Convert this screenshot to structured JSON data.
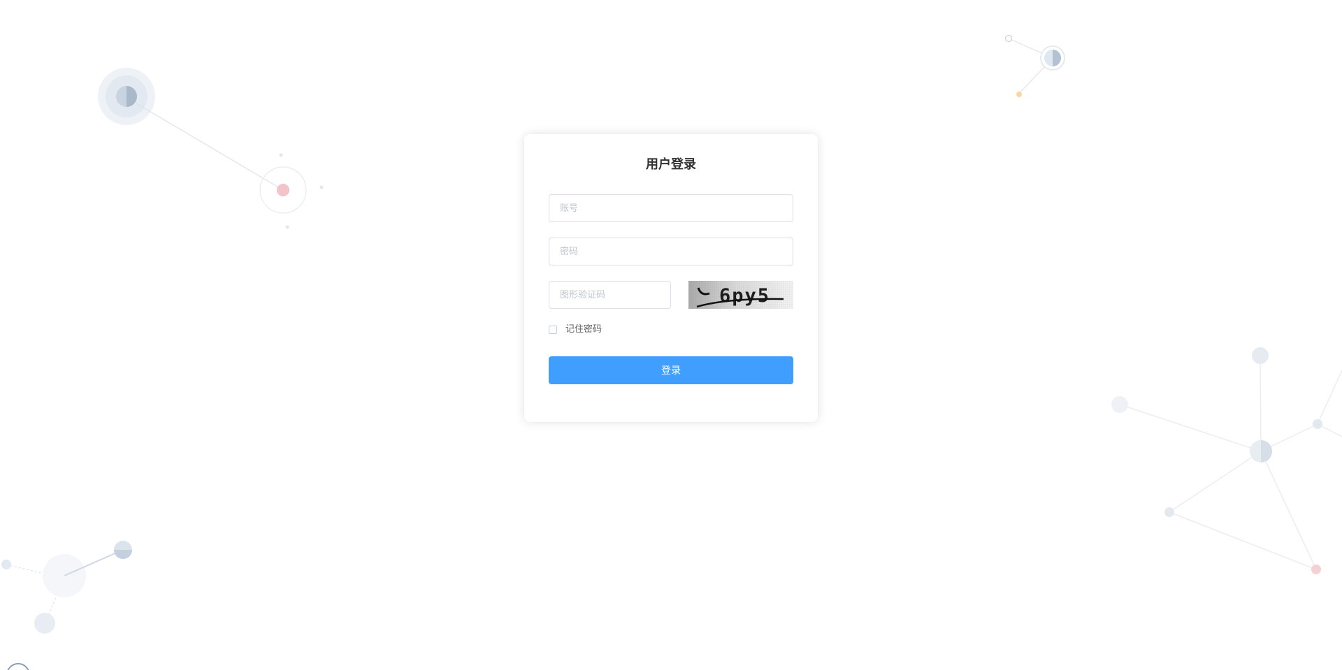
{
  "login": {
    "title": "用户登录",
    "account": {
      "value": "",
      "placeholder": "账号"
    },
    "password": {
      "value": "",
      "placeholder": "密码"
    },
    "captcha": {
      "value": "",
      "placeholder": "图形验证码",
      "image_text": "6py5"
    },
    "remember": {
      "label": "记住密码",
      "checked": false
    },
    "submit_label": "登录"
  },
  "colors": {
    "primary": "#409eff",
    "title_text": "#333333",
    "border": "#dcdfe6",
    "placeholder": "#c0c4cc",
    "accent_red": "#f2b7be",
    "accent_orange": "#f7d7a3",
    "decor_blue": "#c5d3e2"
  }
}
